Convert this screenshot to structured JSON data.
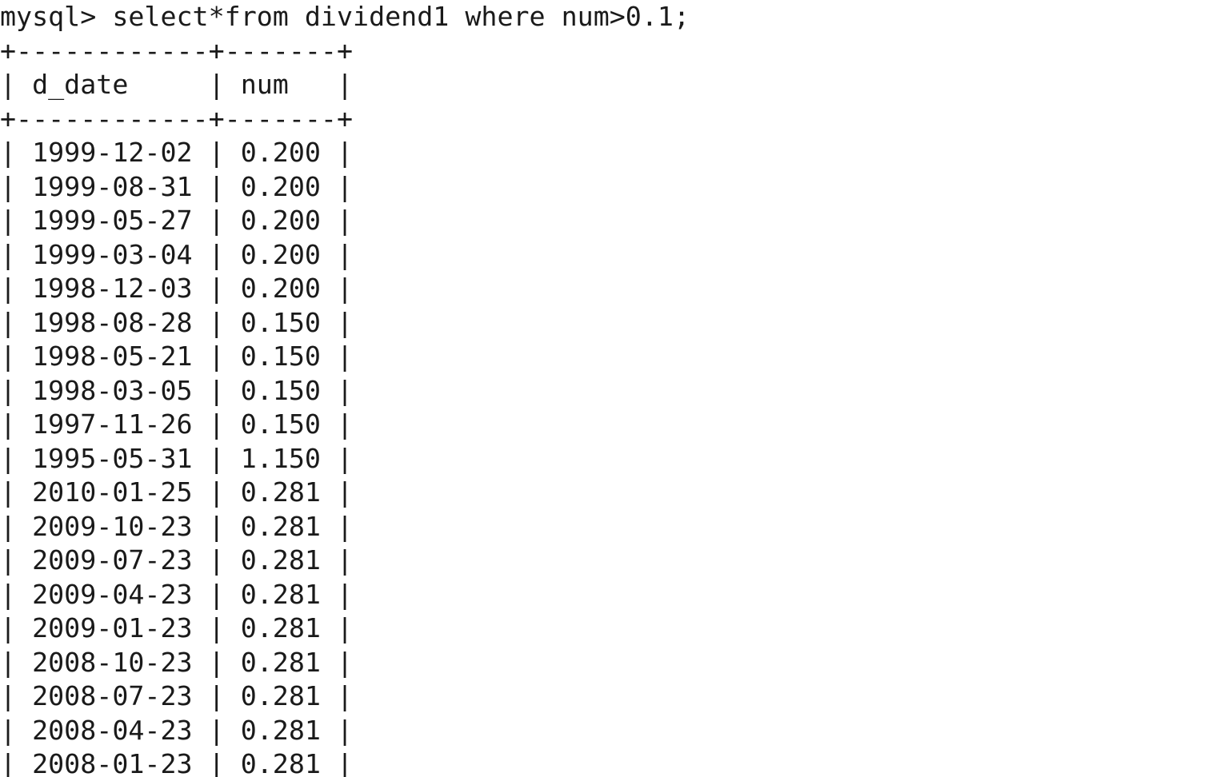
{
  "terminal": {
    "command": "mysql> select*from dividend1 where num>0.1;",
    "border": "+------------+-------+",
    "columns": [
      "d_date",
      "num"
    ],
    "rows": [
      [
        "1999-12-02",
        "0.200"
      ],
      [
        "1999-08-31",
        "0.200"
      ],
      [
        "1999-05-27",
        "0.200"
      ],
      [
        "1999-03-04",
        "0.200"
      ],
      [
        "1998-12-03",
        "0.200"
      ],
      [
        "1998-08-28",
        "0.150"
      ],
      [
        "1998-05-21",
        "0.150"
      ],
      [
        "1998-03-05",
        "0.150"
      ],
      [
        "1997-11-26",
        "0.150"
      ],
      [
        "1995-05-31",
        "1.150"
      ],
      [
        "2010-01-25",
        "0.281"
      ],
      [
        "2009-10-23",
        "0.281"
      ],
      [
        "2009-07-23",
        "0.281"
      ],
      [
        "2009-04-23",
        "0.281"
      ],
      [
        "2009-01-23",
        "0.281"
      ],
      [
        "2008-10-23",
        "0.281"
      ],
      [
        "2008-07-23",
        "0.281"
      ],
      [
        "2008-04-23",
        "0.281"
      ],
      [
        "2008-01-23",
        "0.281"
      ]
    ]
  },
  "colors": {
    "background": "#ffffff",
    "text": "#1a1a1a"
  }
}
